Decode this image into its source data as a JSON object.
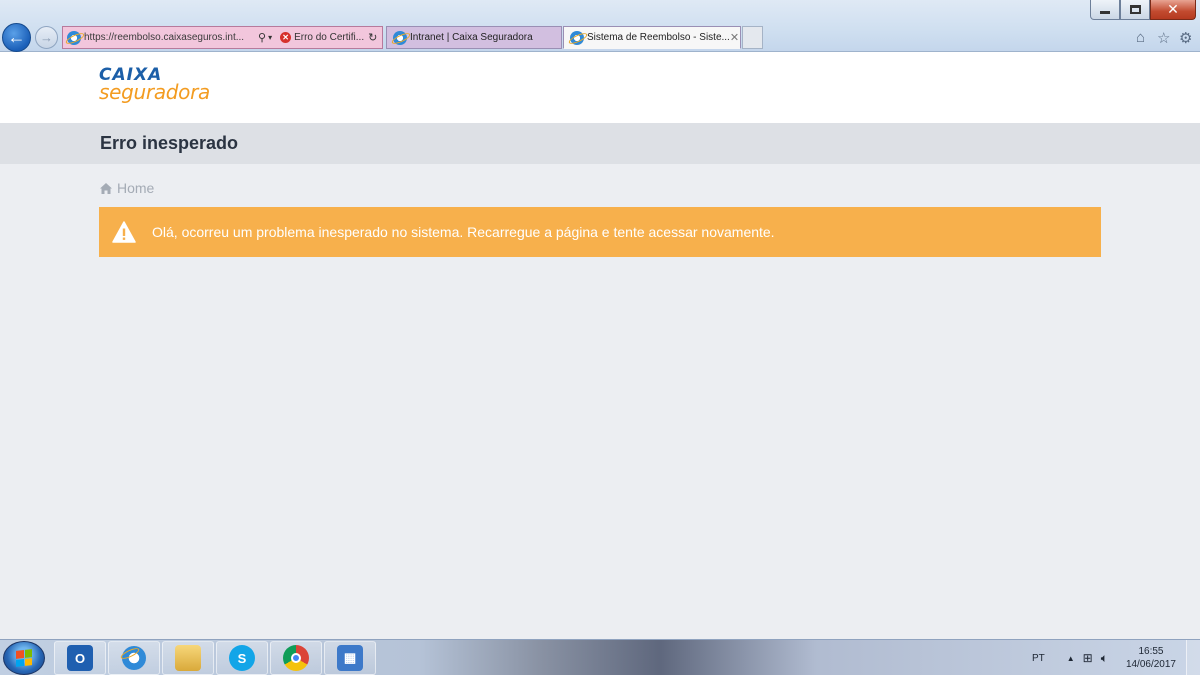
{
  "browser": {
    "address_url_host": "https://reembolso.caixaseguros.int...",
    "certificate_status": "Erro do Certifi...",
    "tabs": [
      {
        "label": "Intranet | Caixa Seguradora"
      },
      {
        "label": "Sistema de Reembolso - Siste...",
        "active": true
      }
    ],
    "icons": [
      "back-arrow-icon",
      "forward-arrow-icon",
      "search-icon",
      "refresh-icon",
      "home-icon",
      "favorites-star-icon",
      "tools-gear-icon"
    ]
  },
  "header": {
    "logo_top": "CAIXA",
    "logo_bottom": "seguradora"
  },
  "page": {
    "title": "Erro inesperado",
    "breadcrumb": "Home",
    "alert_message": "Olá, ocorreu um problema inesperado no sistema. Recarregue a página e tente acessar novamente."
  },
  "taskbar": {
    "apps": [
      "outlook",
      "internet-explorer",
      "file-explorer",
      "skype",
      "chrome",
      "remote-desktop"
    ],
    "language": "PT",
    "time": "16:55",
    "date": "14/06/2017"
  },
  "colors": {
    "alert_bg": "#f7b04c",
    "brand_blue": "#1c5fa8",
    "brand_orange": "#f39c21",
    "title_bar": "#dde0e5",
    "page_bg": "#eceef2"
  }
}
